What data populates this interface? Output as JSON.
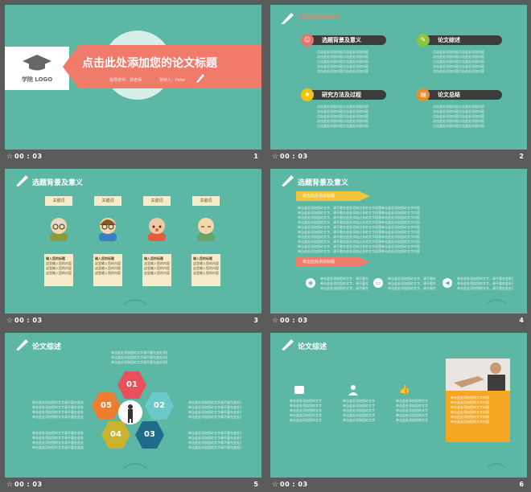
{
  "slides": [
    {
      "number": "1",
      "time": "00 : 03",
      "logo_text": "学院 LOGO",
      "title": "点击此处添加您的论文标题",
      "advisor": "指导老师：郭老师",
      "presenter": "答辩人：Peter"
    },
    {
      "number": "2",
      "time": "00 : 03",
      "heading": "Contents",
      "items": [
        {
          "label": "选题背景及意义",
          "icon": "user-icon",
          "color": "#e8736b"
        },
        {
          "label": "论文综述",
          "icon": "wrench-icon",
          "color": "#8cc63f"
        },
        {
          "label": "研究方法及过程",
          "icon": "medal-icon",
          "color": "#f1c40f"
        },
        {
          "label": "论文总结",
          "icon": "chart-icon",
          "color": "#f08c2c"
        }
      ],
      "filler": "点击此处添加内容点击此处添加内容"
    },
    {
      "number": "3",
      "time": "00 : 03",
      "heading": "选题背景及意义",
      "keywords": [
        "关键词",
        "关键词",
        "关键词",
        "关键词"
      ],
      "note_title": "输入您的标题",
      "note_line": "这里输入您的内容"
    },
    {
      "number": "4",
      "time": "00 : 03",
      "heading": "选题背景及意义",
      "banner1": "单击此处添加标题",
      "banner2": "单击此处添加标题",
      "filler": "单击此处添加您的文字，请不要在此处添加过长的文字段落单击此处添加您的文字内容"
    },
    {
      "number": "5",
      "time": "00 : 03",
      "heading": "论文综述",
      "hexes": [
        {
          "label": "01",
          "color": "#e8505b"
        },
        {
          "label": "02",
          "color": "#6cc9c9"
        },
        {
          "label": "03",
          "color": "#1f6b8c"
        },
        {
          "label": "04",
          "color": "#c9b22c"
        },
        {
          "label": "05",
          "color": "#ee7d2f"
        }
      ],
      "filler": "单击此处添加您的文字请不要在此处添加过长的文字段落"
    },
    {
      "number": "6",
      "time": "00 : 03",
      "heading": "论文综述",
      "filler": "单击此处添加您的文字内容"
    }
  ],
  "colors": {
    "bg": "#5cb8a4",
    "accent": "#f07b6b",
    "frame": "#5b5b5b"
  }
}
